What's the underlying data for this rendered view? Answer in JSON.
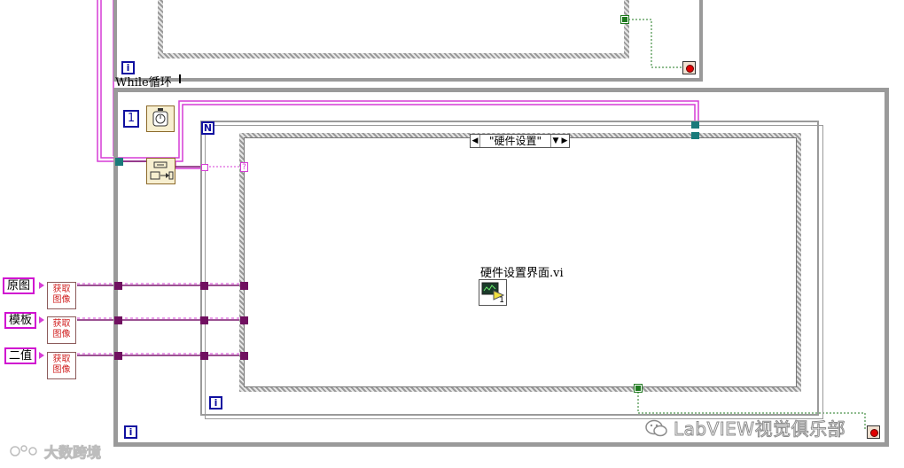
{
  "loop": {
    "while_label": "While循环",
    "for_n_label": "N",
    "iteration_label": "i",
    "numeric_constant": "1"
  },
  "case": {
    "selector_value": "\"硬件设置\""
  },
  "subvi": {
    "name": "硬件设置界面.vi",
    "terminal_index": "1"
  },
  "controls": [
    {
      "label": "原图",
      "function": "获取\n图像"
    },
    {
      "label": "模板",
      "function": "获取\n图像"
    },
    {
      "label": "二值",
      "function": "获取\n图像"
    }
  ],
  "tunnel_glyph": "?",
  "watermarks": {
    "right": "LabVIEW视觉俱乐部",
    "left": "大数跨境"
  },
  "colors": {
    "wire_pink": "#d63cd6",
    "wire_purple": "#7a1a6e",
    "wire_green": "#1f7a1f",
    "structure_gray": "#9a9a9a",
    "terminal_blue": "#1010a0"
  }
}
